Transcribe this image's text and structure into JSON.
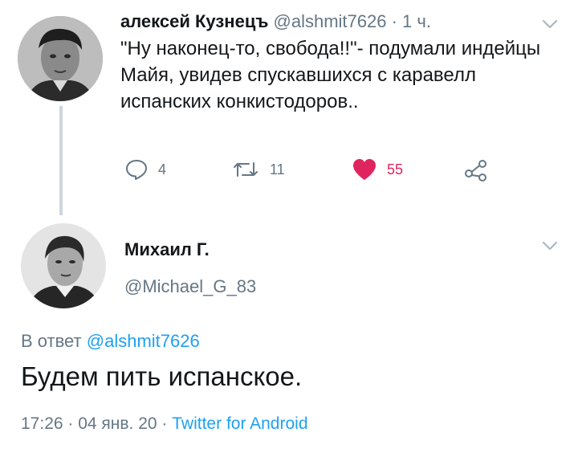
{
  "tweet1": {
    "author_name": "алексей Кузнецъ",
    "handle": "@alshmit7626",
    "separator": " · ",
    "time": "1 ч.",
    "text": "\"Ну наконец-то, свобода!!\"- подумали индейцы Майя, увидев спускавшихся с каравелл испанских конкистодоров..",
    "actions": {
      "reply_count": "4",
      "retweet_count": "11",
      "like_count": "55"
    },
    "icons": [
      "avatar",
      "chevron-down-icon",
      "reply-icon",
      "retweet-icon",
      "heart-icon",
      "share-icon"
    ]
  },
  "tweet2": {
    "author_name": "Михаил Г.",
    "handle": "@Michael_G_83",
    "reply_prefix": "В ответ ",
    "reply_mention": "@alshmit7626",
    "text": "Будем пить испанское.",
    "time": "17:26",
    "sep1": " · ",
    "date": "04 янв. 20",
    "sep2": " · ",
    "source": "Twitter for Android",
    "icons": [
      "avatar",
      "chevron-down-icon"
    ]
  },
  "colors": {
    "text": "#14171a",
    "muted": "#657786",
    "link": "#1da1f2",
    "like": "#e0245e",
    "thread_line": "#ccd6dd"
  }
}
